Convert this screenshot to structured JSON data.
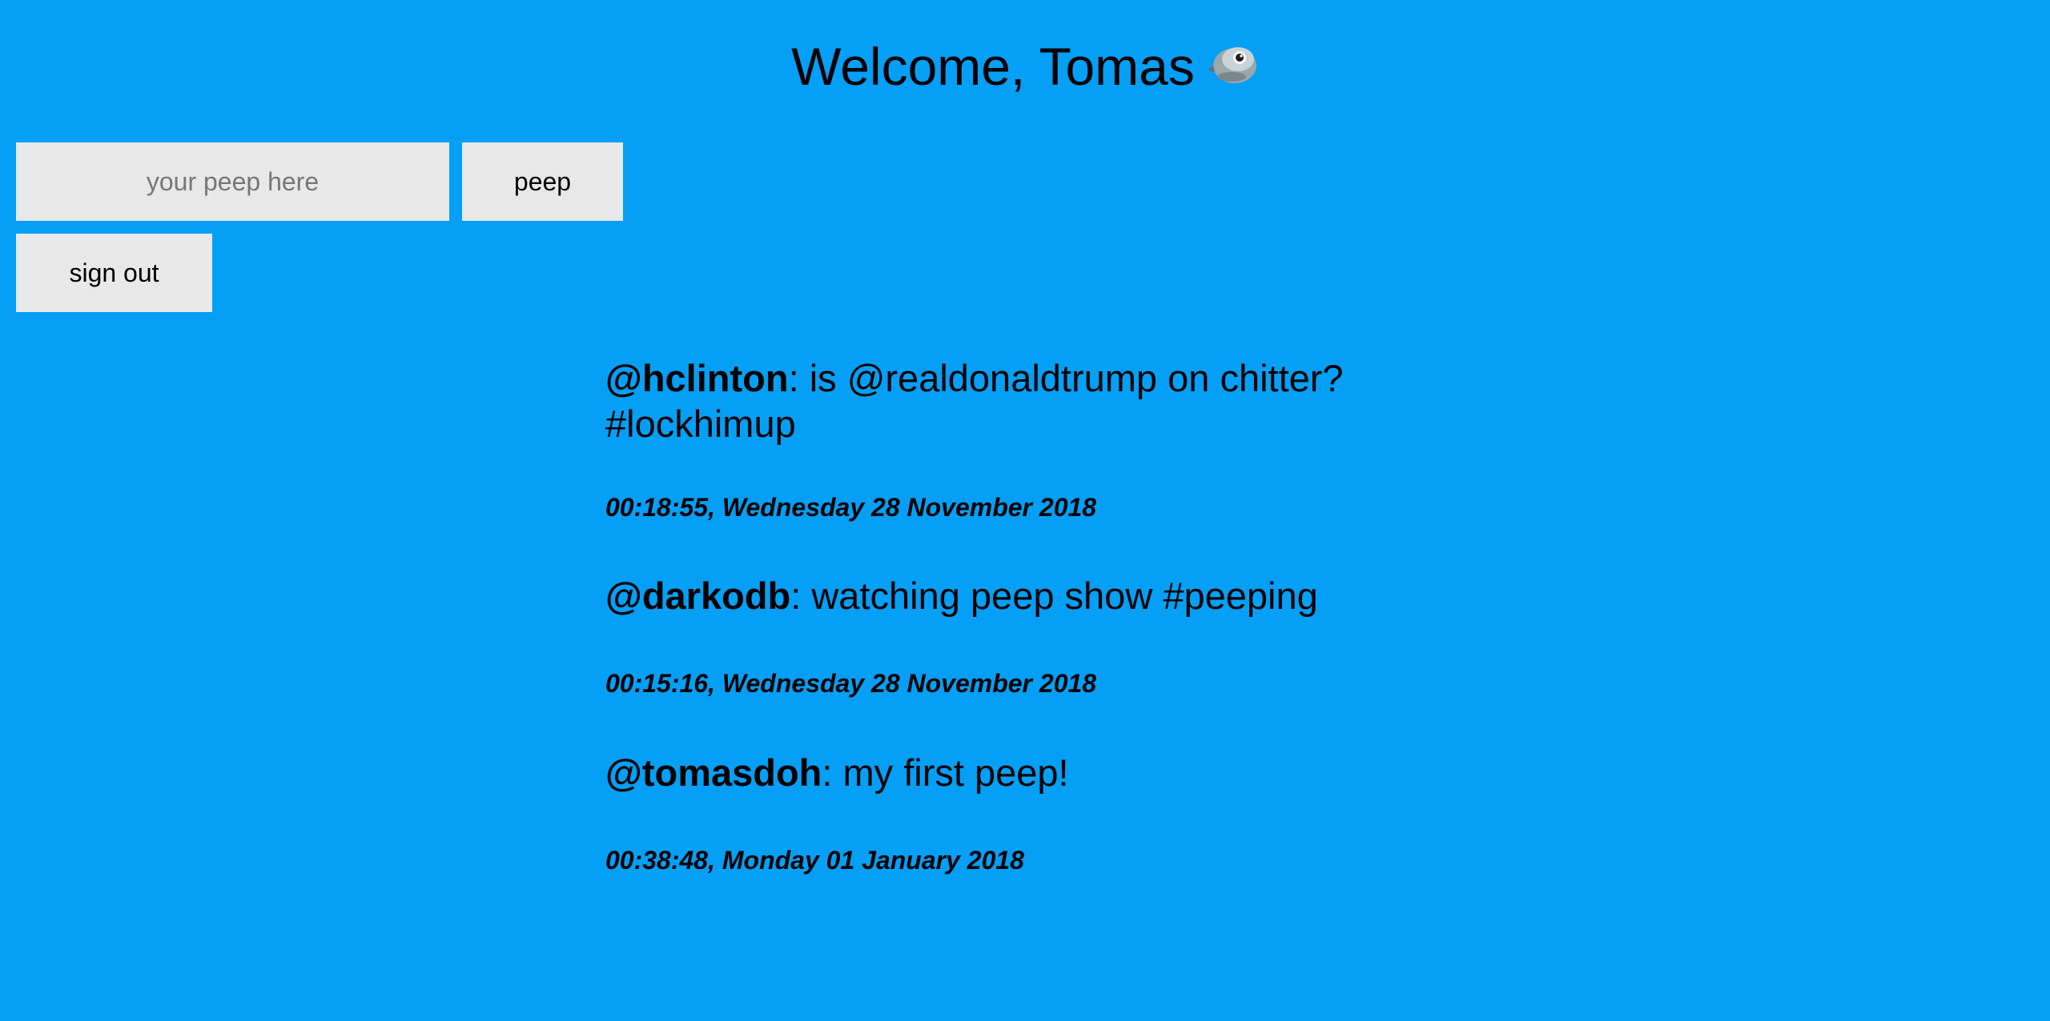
{
  "header": {
    "title": "Welcome, Tomas",
    "icon": "bird-icon"
  },
  "compose": {
    "placeholder": "your peep here",
    "value": "",
    "peep_label": "peep"
  },
  "account": {
    "sign_out_label": "sign out"
  },
  "feed": [
    {
      "user": "@hclinton",
      "text": ": is @realdonaldtrump on chitter? #lockhimup",
      "time": "00:18:55, Wednesday 28 November 2018"
    },
    {
      "user": "@darkodb",
      "text": ": watching peep show #peeping",
      "time": "00:15:16, Wednesday 28 November 2018"
    },
    {
      "user": "@tomasdoh",
      "text": ": my first peep!",
      "time": "00:38:48, Monday 01 January 2018"
    }
  ],
  "colors": {
    "background": "#059ff5",
    "control": "#e8e8e8"
  }
}
